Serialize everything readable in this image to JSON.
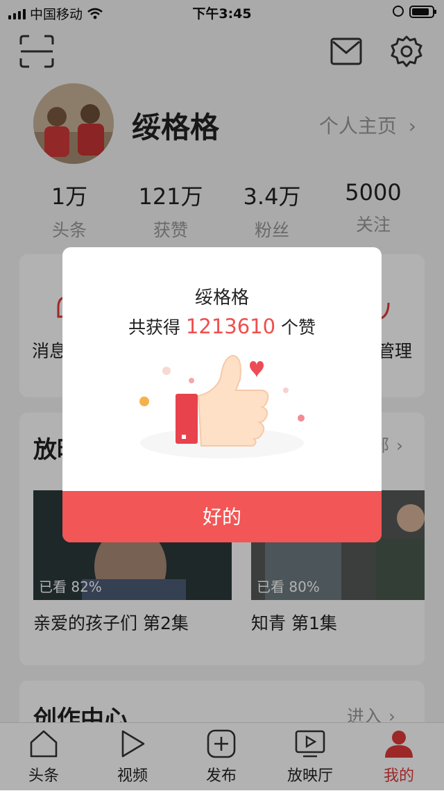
{
  "status_bar": {
    "carrier": "中国移动",
    "time": "下午3:45"
  },
  "profile": {
    "name": "绥格格",
    "homepage_link": "个人主页",
    "stats": [
      {
        "value": "1万",
        "label": "头条"
      },
      {
        "value": "121万",
        "label": "获赞"
      },
      {
        "value": "3.4万",
        "label": "粉丝"
      },
      {
        "value": "5000",
        "label": "关注"
      }
    ]
  },
  "shortcuts": {
    "left_label": "消息",
    "right_label": "管理"
  },
  "history": {
    "title": "放映",
    "more": "部",
    "videos": [
      {
        "watched": "已看 82%",
        "title": "亲爱的孩子们 第2集"
      },
      {
        "watched": "已看 80%",
        "title": "知青 第1集"
      }
    ]
  },
  "creator": {
    "title": "创作中心",
    "enter": "进入"
  },
  "tabbar": {
    "tabs": [
      {
        "label": "头条",
        "icon": "home-icon"
      },
      {
        "label": "视频",
        "icon": "play-icon"
      },
      {
        "label": "发布",
        "icon": "plus-icon"
      },
      {
        "label": "放映厅",
        "icon": "tv-icon"
      },
      {
        "label": "我的",
        "icon": "person-icon"
      }
    ],
    "active_index": 4
  },
  "modal": {
    "name": "绥格格",
    "prefix": "共获得",
    "count": "1213610",
    "suffix": "个赞",
    "ok_label": "好的"
  },
  "colors": {
    "accent": "#f25656",
    "highlight": "#ef4f4f",
    "active_tab": "#e03a3a"
  }
}
